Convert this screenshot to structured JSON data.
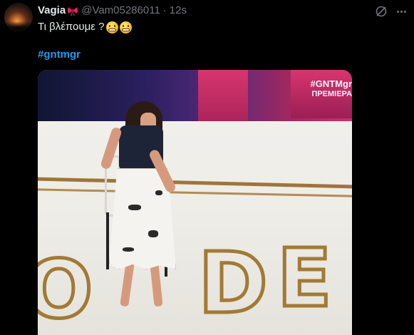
{
  "user": {
    "name": "Vagia",
    "handle": "@Vam05286011",
    "separator": "·",
    "time": "12s"
  },
  "tweet": {
    "text": "Τι βλέπουμε ?",
    "emojis": [
      "grimacing-face-emoji",
      "grimacing-face-emoji"
    ],
    "hashtag": "#gntmgr"
  },
  "media": {
    "screen_title": "#GNTMgr",
    "screen_subtitle": "ΠΡΕΜΙΕΡΑ",
    "floor_letters": [
      "O",
      "D",
      "E"
    ]
  },
  "icons": {
    "bow": "red-bow-emoji",
    "grok": "grok-icon",
    "more": "more-icon"
  },
  "colors": {
    "background": "#000000",
    "text": "#e7e9ea",
    "muted": "#71767b",
    "link": "#1d9bf0",
    "bow": "#e0245e"
  }
}
